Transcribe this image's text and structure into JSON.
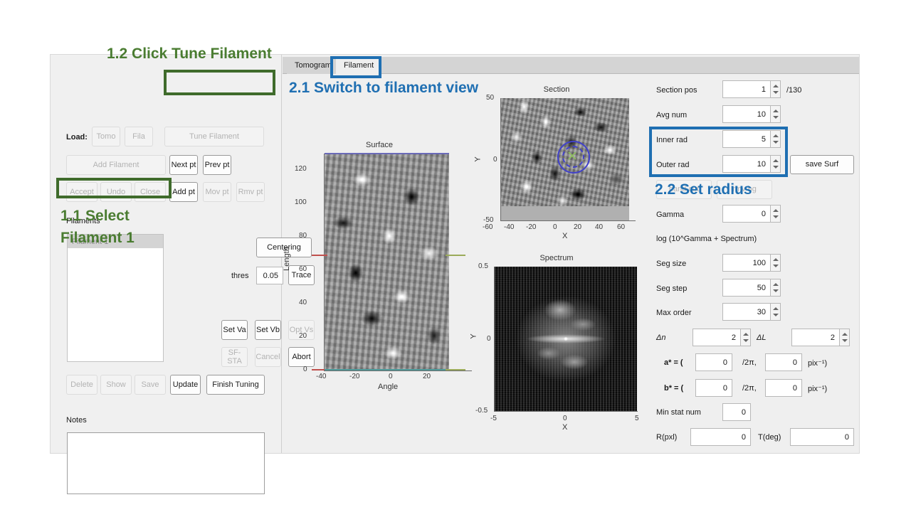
{
  "annotations": {
    "green_color": "#4a7c31",
    "blue_color": "#1f6fb2",
    "step_1_2": "1.2 Click Tune Filament",
    "step_1_1_line1": "1.1 Select",
    "step_1_1_line2": "Filament 1",
    "step_2_1": "2.1 Switch to filament view",
    "step_2_2": "2.2 Set radius"
  },
  "left_panel": {
    "load_label": "Load:",
    "filaments_label": "Filaments",
    "notes_label": "Notes",
    "thres_label": "thres",
    "thres_value": "0.05",
    "notes_value": "",
    "filament_list": [
      "Filament 1"
    ],
    "buttons": {
      "tomo": "Tomo",
      "fila": "Fila",
      "tune_filament": "Tune Filament",
      "add_filament": "Add Filament",
      "next_pt": "Next pt",
      "prev_pt": "Prev pt",
      "accept": "Accept",
      "undo": "Undo",
      "close": "Close",
      "add_pt": "Add pt",
      "mov_pt": "Mov pt",
      "rmv_pt": "Rmv pt",
      "centering": "Centering",
      "trace": "Trace",
      "set_va": "Set Va",
      "set_vb": "Set Vb",
      "opt_vs": "Opt Vs",
      "sf_sta": "SF-STA",
      "cancel": "Cancel",
      "abort": "Abort",
      "delete": "Delete",
      "show": "Show",
      "save": "Save",
      "update": "Update",
      "finish_tuning": "Finish Tuning"
    }
  },
  "tabs": [
    {
      "label": "Tomogram",
      "active": false
    },
    {
      "label": "Filament",
      "active": true
    }
  ],
  "right_panel": {
    "fields": {
      "section_pos_label": "Section pos",
      "section_pos_value": "1",
      "section_pos_suffix": "/130",
      "avg_num_label": "Avg num",
      "avg_num_value": "10",
      "inner_rad_label": "Inner rad",
      "inner_rad_value": "5",
      "outer_rad_label": "Outer rad",
      "outer_rad_value": "10",
      "gamma_label": "Gamma",
      "gamma_value": "0",
      "gamma_note": "log (10^Gamma + Spectrum)",
      "seg_size_label": "Seg size",
      "seg_size_value": "100",
      "seg_step_label": "Seg step",
      "seg_step_value": "50",
      "max_order_label": "Max order",
      "max_order_value": "30",
      "dn_label": "Δn",
      "dn_value": "2",
      "dl_label": "ΔL",
      "dl_value": "2",
      "astar_label": "a* = (",
      "astar_v1": "0",
      "astar_mid": "/2π,",
      "astar_v2": "0",
      "astar_unit": "pix⁻¹)",
      "bstar_label": "b* = (",
      "bstar_v1": "0",
      "bstar_mid": "/2π,",
      "bstar_v2": "0",
      "bstar_unit": "pix⁻¹)",
      "min_stat_num_label": "Min stat num",
      "min_stat_num_value": "0",
      "rpxl_label": "R(pxl)",
      "rpxl_value": "0",
      "tdeg_label": "T(deg)",
      "tdeg_value": "0"
    },
    "buttons": {
      "save_surf": "save Surf",
      "band_cut": "band cut",
      "rmv_bg": "rmv bg"
    }
  },
  "chart_data": [
    {
      "type": "heatmap",
      "title": "Surface",
      "xlabel": "Angle",
      "ylabel": "Length",
      "xlim": [
        -40,
        30
      ],
      "ylim": [
        0,
        130
      ],
      "xticks": [
        "-40",
        "-20",
        "0",
        "20"
      ],
      "yticks": [
        "0",
        "20",
        "40",
        "60",
        "80",
        "100",
        "120"
      ],
      "marker_lines": [
        {
          "name": "top-boundary",
          "color": "#6a6ab8",
          "y": 130,
          "side": "full"
        },
        {
          "name": "left-marker",
          "color": "#c0504d",
          "y": 62,
          "side": "left"
        },
        {
          "name": "right-marker",
          "color": "#9bab5a",
          "y": 62,
          "side": "right"
        },
        {
          "name": "bottom-left",
          "color": "#c0504d",
          "y": 0,
          "side": "left"
        },
        {
          "name": "bottom-right",
          "color": "#9bab5a",
          "y": 0,
          "side": "right"
        },
        {
          "name": "bottom-boundary",
          "color": "#4e9a9a",
          "y": 0,
          "side": "full"
        }
      ]
    },
    {
      "type": "heatmap",
      "title": "Section",
      "xlabel": "X",
      "ylabel": "Y",
      "xlim": [
        -65,
        65
      ],
      "ylim": [
        -50,
        50
      ],
      "xticks": [
        "-60",
        "-40",
        "-20",
        "0",
        "20",
        "40",
        "60"
      ],
      "yticks": [
        "50",
        "0",
        "-50"
      ],
      "overlays": [
        {
          "name": "outer-radius-circle",
          "shape": "circle",
          "style": "solid",
          "color": "#4040c8",
          "radius": 10,
          "center": [
            0,
            0
          ]
        },
        {
          "name": "inner-radius-circle",
          "shape": "circle",
          "style": "dashed",
          "color": "#4040c8",
          "radius": 5,
          "center": [
            0,
            0
          ]
        },
        {
          "name": "center-cross",
          "shape": "x-marker",
          "color": "#8fbf5f",
          "center": [
            0,
            0
          ]
        }
      ]
    },
    {
      "type": "heatmap",
      "title": "Spectrum",
      "xlabel": "X",
      "ylabel": "Y",
      "xlim": [
        -5,
        5
      ],
      "ylim": [
        -0.5,
        0.5
      ],
      "xticks": [
        "-5",
        "0",
        "5"
      ],
      "yticks": [
        "0.5",
        "0",
        "-0.5"
      ]
    }
  ]
}
